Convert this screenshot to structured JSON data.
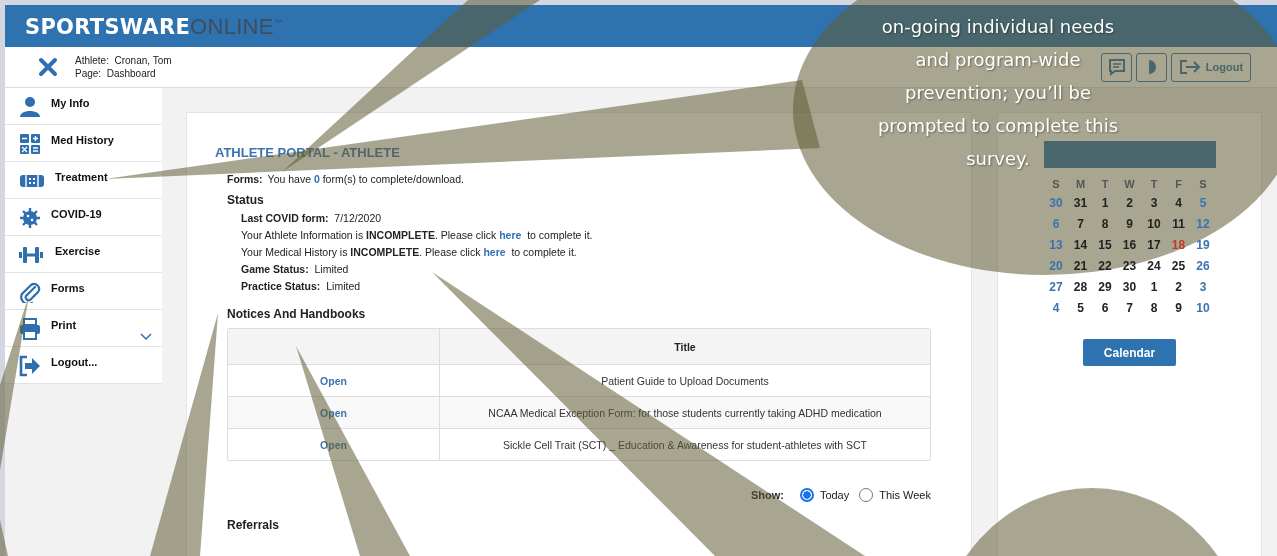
{
  "header": {
    "logo": {
      "primary": "SPORTSWARE",
      "secondary": "ONLINE",
      "mark": "™"
    }
  },
  "subheader": {
    "athlete": "Athlete:  Cronan, Tom",
    "page": "Page:  Dashboard",
    "logout": "Logout"
  },
  "sidebar": {
    "items": [
      {
        "label": "My Info",
        "has_menu": false
      },
      {
        "label": "Med History",
        "has_menu": false
      },
      {
        "label": "Treatment",
        "has_menu": false
      },
      {
        "label": "COVID-19",
        "has_menu": false
      },
      {
        "label": "Exercise",
        "has_menu": false
      },
      {
        "label": "Forms",
        "has_menu": false
      },
      {
        "label": "Print",
        "has_menu": true
      },
      {
        "label": "Logout...",
        "has_menu": false
      }
    ]
  },
  "portal": {
    "title": "ATHLETE PORTAL - ATHLETE",
    "forms": {
      "label": "Forms:",
      "parts": [
        {
          "kind": "plain",
          "text": "You have "
        },
        {
          "kind": "count",
          "text": "0"
        },
        {
          "kind": "plain",
          "text": " form(s) to complete/download."
        }
      ]
    },
    "status_heading": "Status",
    "status_lines": [
      [
        {
          "kind": "bold",
          "text": "Last COVID form:"
        },
        {
          "kind": "plain",
          "text": "  7/12/2020"
        }
      ],
      [
        {
          "kind": "plain",
          "text": "Your Athlete Information is "
        },
        {
          "kind": "bold",
          "text": "INCOMPLETE"
        },
        {
          "kind": "plain",
          "text": ". Please click "
        },
        {
          "kind": "link",
          "text": "here"
        },
        {
          "kind": "plain",
          "text": "  to complete it."
        }
      ],
      [
        {
          "kind": "plain",
          "text": "Your Medical History is "
        },
        {
          "kind": "bold",
          "text": "INCOMPLETE"
        },
        {
          "kind": "plain",
          "text": ". Please click "
        },
        {
          "kind": "link",
          "text": "here"
        },
        {
          "kind": "plain",
          "text": "  to complete it."
        }
      ],
      [
        {
          "kind": "bold",
          "text": "Game Status:"
        },
        {
          "kind": "plain",
          "text": "  Limited"
        }
      ],
      [
        {
          "kind": "bold",
          "text": "Practice Status:"
        },
        {
          "kind": "plain",
          "text": "  Limited"
        }
      ]
    ],
    "notices_heading": "Notices And Handbooks",
    "table": {
      "title_column": "Title",
      "rows": [
        {
          "action": "Open",
          "title": "Patient Guide to Upload Documents"
        },
        {
          "action": "Open",
          "title": "NCAA Medical Exception Form: for those students currently taking ADHD medication"
        },
        {
          "action": "Open",
          "title": "Sickle Cell Trait (SCT) _ Education & Awareness for student-athletes with SCT"
        }
      ]
    },
    "show": {
      "label": "Show:",
      "options": [
        {
          "label": "Today",
          "selected": true
        },
        {
          "label": "This Week",
          "selected": false
        }
      ]
    },
    "referrals_heading": "Referrals"
  },
  "calendar": {
    "weekdays": [
      "S",
      "M",
      "T",
      "W",
      "T",
      "F",
      "S"
    ],
    "weeks": [
      [
        {
          "text": "30",
          "color": "#3a73b0"
        },
        {
          "text": "31",
          "color": "#222222"
        },
        {
          "text": "1",
          "color": "#222222"
        },
        {
          "text": "2",
          "color": "#222222"
        },
        {
          "text": "3",
          "color": "#222222"
        },
        {
          "text": "4",
          "color": "#222222"
        },
        {
          "text": "5",
          "color": "#3a73b0"
        }
      ],
      [
        {
          "text": "6",
          "color": "#3a73b0"
        },
        {
          "text": "7",
          "color": "#222222"
        },
        {
          "text": "8",
          "color": "#222222"
        },
        {
          "text": "9",
          "color": "#222222"
        },
        {
          "text": "10",
          "color": "#222222"
        },
        {
          "text": "11",
          "color": "#222222"
        },
        {
          "text": "12",
          "color": "#3a73b0"
        }
      ],
      [
        {
          "text": "13",
          "color": "#3a73b0"
        },
        {
          "text": "14",
          "color": "#222222"
        },
        {
          "text": "15",
          "color": "#222222"
        },
        {
          "text": "16",
          "color": "#222222"
        },
        {
          "text": "17",
          "color": "#222222"
        },
        {
          "text": "18",
          "color": "#c0392b"
        },
        {
          "text": "19",
          "color": "#3a73b0"
        }
      ],
      [
        {
          "text": "20",
          "color": "#3a73b0"
        },
        {
          "text": "21",
          "color": "#222222"
        },
        {
          "text": "22",
          "color": "#222222"
        },
        {
          "text": "23",
          "color": "#222222"
        },
        {
          "text": "24",
          "color": "#222222"
        },
        {
          "text": "25",
          "color": "#222222"
        },
        {
          "text": "26",
          "color": "#3a73b0"
        }
      ],
      [
        {
          "text": "27",
          "color": "#3a73b0"
        },
        {
          "text": "28",
          "color": "#222222"
        },
        {
          "text": "29",
          "color": "#222222"
        },
        {
          "text": "30",
          "color": "#222222"
        },
        {
          "text": "1",
          "color": "#222222"
        },
        {
          "text": "2",
          "color": "#222222"
        },
        {
          "text": "3",
          "color": "#3a73b0"
        }
      ],
      [
        {
          "text": "4",
          "color": "#3a73b0"
        },
        {
          "text": "5",
          "color": "#222222"
        },
        {
          "text": "6",
          "color": "#222222"
        },
        {
          "text": "7",
          "color": "#222222"
        },
        {
          "text": "8",
          "color": "#222222"
        },
        {
          "text": "9",
          "color": "#222222"
        },
        {
          "text": "10",
          "color": "#3a73b0"
        }
      ]
    ],
    "button": "Calendar"
  },
  "callout": {
    "lines": [
      "on-going individual needs",
      "and program-wide",
      "prevention; you’ll be",
      "prompted to complete this",
      "survey."
    ]
  }
}
